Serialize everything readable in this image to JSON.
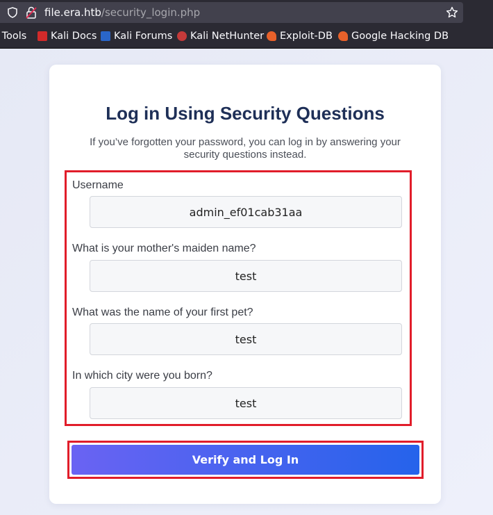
{
  "browser": {
    "url_host": "file.era.htb",
    "url_path": "/security_login.php",
    "bookmarks": [
      {
        "label": "i Tools"
      },
      {
        "label": "Kali Docs"
      },
      {
        "label": "Kali Forums"
      },
      {
        "label": "Kali NetHunter"
      },
      {
        "label": "Exploit-DB"
      },
      {
        "label": "Google Hacking DB"
      }
    ]
  },
  "form": {
    "title": "Log in Using Security Questions",
    "subtitle": "If you’ve forgotten your password, you can log in by answering your security questions instead.",
    "fields": [
      {
        "label": "Username",
        "value": "admin_ef01cab31aa"
      },
      {
        "label": "What is your mother's maiden name?",
        "value": "test"
      },
      {
        "label": "What was the name of your first pet?",
        "value": "test"
      },
      {
        "label": "In which city were you born?",
        "value": "test"
      }
    ],
    "submit_label": "Verify and Log In"
  },
  "colors": {
    "title": "#1e2f57",
    "highlight_border": "#e11d2a",
    "button_gradient_start": "#6a63f3",
    "button_gradient_end": "#2563eb"
  }
}
